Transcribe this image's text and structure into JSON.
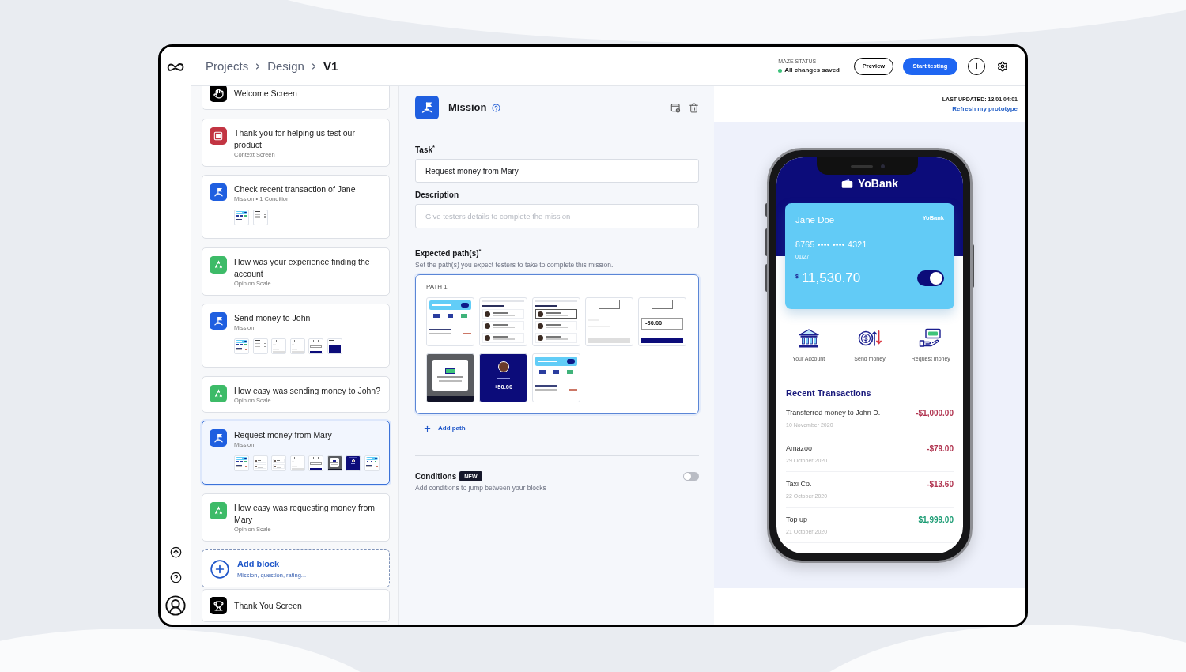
{
  "header": {
    "breadcrumb": [
      {
        "label": "Projects",
        "current": false
      },
      {
        "label": "Design",
        "current": false
      },
      {
        "label": "V1",
        "current": true
      }
    ],
    "status": {
      "label": "MAZE STATUS",
      "text": "All changes saved"
    },
    "buttons": [
      {
        "label": "Preview",
        "kind": "outline"
      },
      {
        "label": "Start testing",
        "kind": "primary"
      }
    ]
  },
  "blocks": [
    {
      "kind": "welcome",
      "title": "Welcome Screen",
      "selected": false
    },
    {
      "kind": "context",
      "title": "Thank you for helping us test our product",
      "subtitle": "Context Screen",
      "selected": false
    },
    {
      "kind": "mission",
      "title": "Check recent transaction of Jane",
      "subtitle": "Mission • 1 Condition",
      "selected": false,
      "screens": [
        {
          "kind": "home"
        },
        {
          "kind": "detail"
        }
      ]
    },
    {
      "kind": "opinion",
      "title": "How was your experience finding the account",
      "subtitle": "Opinion Scale",
      "selected": false
    },
    {
      "kind": "mission",
      "title": "Send money to John",
      "subtitle": "Mission",
      "selected": false,
      "screens": [
        {
          "kind": "home"
        },
        {
          "kind": "detail"
        },
        {
          "kind": "amount-empty"
        },
        {
          "kind": "amount-empty"
        },
        {
          "kind": "amount-filled"
        },
        {
          "kind": "navy-bottom"
        }
      ]
    },
    {
      "kind": "opinion",
      "title": "How easy was sending money to John?",
      "subtitle": "Opinion Scale",
      "selected": false
    },
    {
      "kind": "mission",
      "title": "Request money from Mary",
      "subtitle": "Mission",
      "selected": true,
      "screens": [
        {
          "kind": "home"
        },
        {
          "kind": "contacts"
        },
        {
          "kind": "contacts"
        },
        {
          "kind": "amount-empty"
        },
        {
          "kind": "amount-filled"
        },
        {
          "kind": "modal"
        },
        {
          "kind": "confirm"
        },
        {
          "kind": "home"
        }
      ]
    },
    {
      "kind": "opinion",
      "title": "How easy was requesting money from Mary",
      "subtitle": "Opinion Scale",
      "selected": false
    },
    {
      "kind": "add",
      "title": "Add block",
      "subtitle": "Mission, question, rating...",
      "selected": false
    },
    {
      "kind": "thankyou",
      "title": "Thank You Screen",
      "selected": false
    }
  ],
  "editor": {
    "title": "Mission",
    "task": {
      "label": "Task$^{*}$",
      "value": "Request money from Mary"
    },
    "description": {
      "label": "Description",
      "placeholder": "Give testers details to complete the mission"
    },
    "paths": {
      "label": "Expected path(s)$^{*}$",
      "hint": "Set the path(s) you expect testers to take to complete this mission.",
      "items": [
        {
          "title": "PATH 1",
          "screens": [
            {
              "kind": "home"
            },
            {
              "kind": "contacts"
            },
            {
              "kind": "contacts-selected"
            },
            {
              "kind": "amount-empty"
            },
            {
              "kind": "amount-filled",
              "amount": "-50.00"
            },
            {
              "kind": "modal"
            },
            {
              "kind": "confirm",
              "amount": "+50.00"
            },
            {
              "kind": "home"
            }
          ]
        }
      ],
      "add_label": "Add path"
    },
    "conditions": {
      "label": "Conditions",
      "badge": "NEW",
      "hint": "Add conditions to jump between your blocks",
      "on": false
    }
  },
  "preview": {
    "last_updated": "LAST UPDATED: 13/01 04:01",
    "refresh_link": "Refresh my prototype",
    "app": {
      "brand": "YoBank",
      "card": {
        "holder": "Jane Doe",
        "brand": "YoBank",
        "number": "8765 •••• •••• 4321",
        "expiry": "01/27",
        "currency": "$",
        "balance": "11,530.70",
        "toggle_on": true
      },
      "actions": [
        {
          "kind": "account",
          "label": "Your Account"
        },
        {
          "kind": "send",
          "label": "Send money"
        },
        {
          "kind": "request",
          "label": "Request money"
        }
      ],
      "section_title": "Recent Transactions",
      "transactions": [
        {
          "name": "Transferred money to John D.",
          "date": "10 November 2020",
          "amount": "-$1,000.00",
          "color": "#b0334f"
        },
        {
          "name": "Amazoo",
          "date": "29 October 2020",
          "amount": "-$79.00",
          "color": "#b0334f"
        },
        {
          "name": "Taxi Co.",
          "date": "22 October 2020",
          "amount": "-$13.60",
          "color": "#b0334f"
        },
        {
          "name": "Top up",
          "date": "21 October 2020",
          "amount": "$1,999.00",
          "color": "#1c9c74"
        }
      ]
    }
  }
}
